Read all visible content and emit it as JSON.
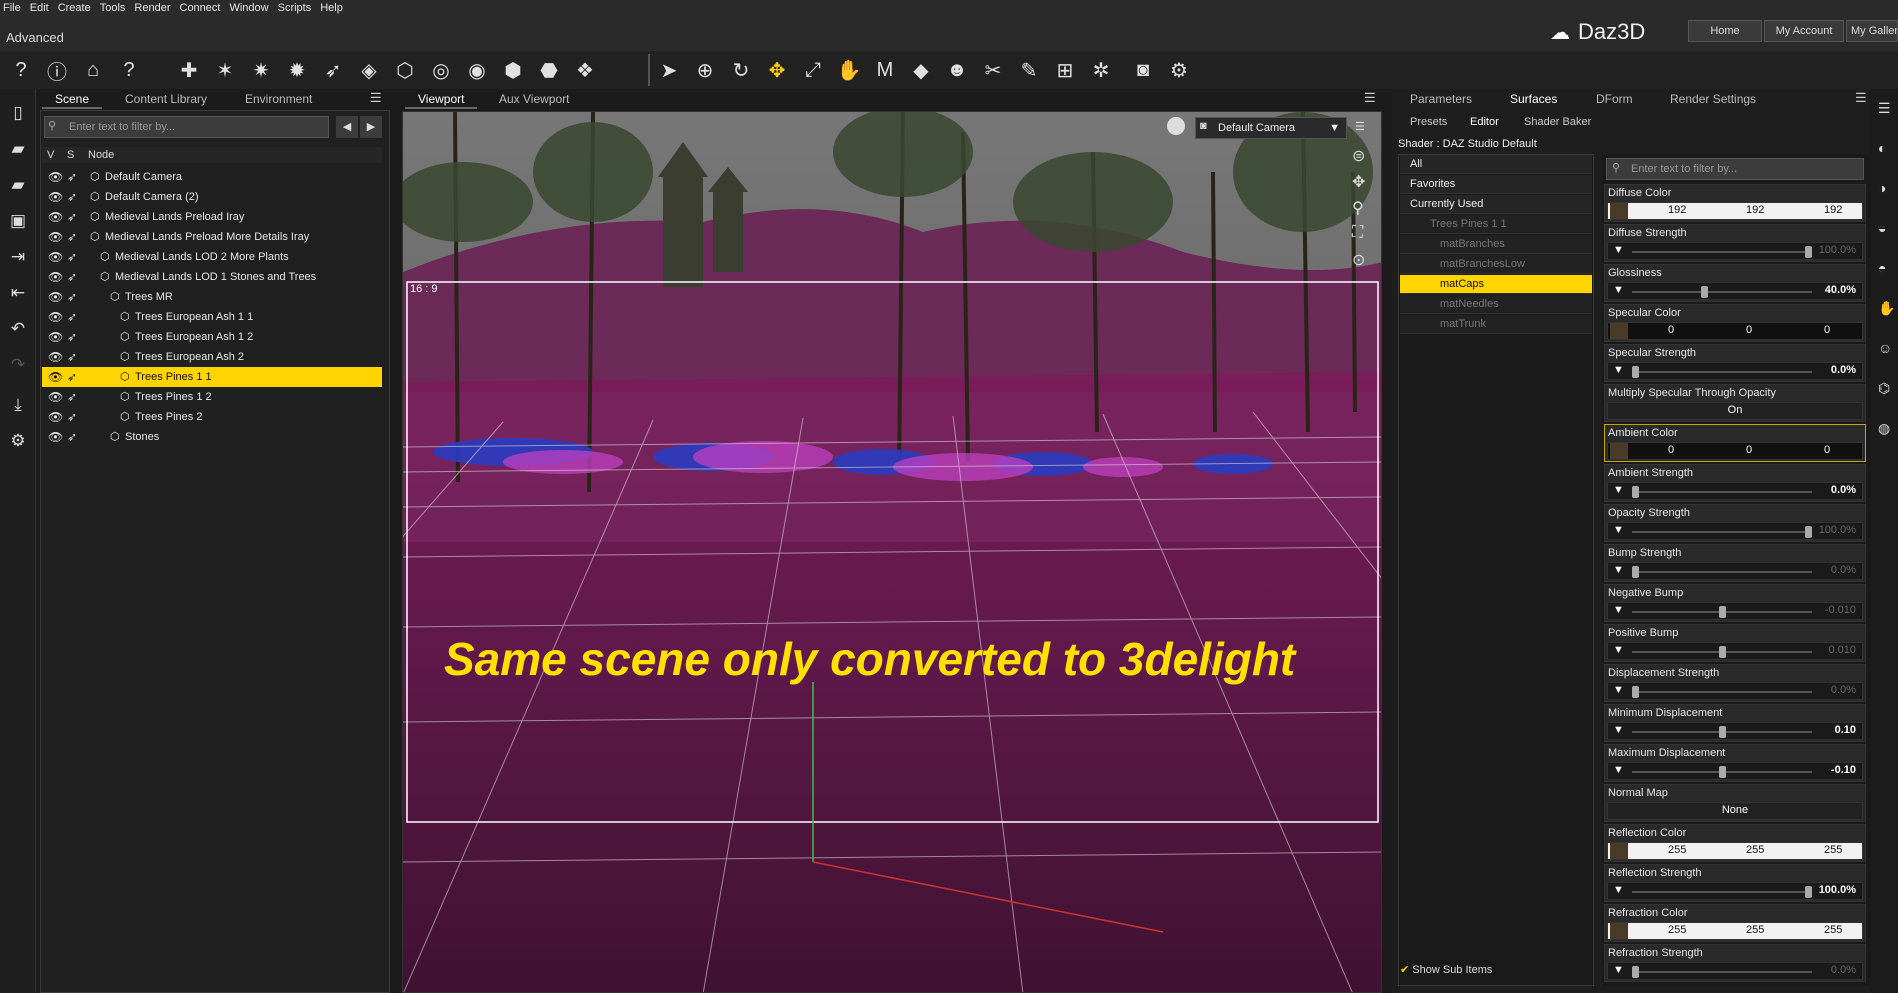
{
  "menu": [
    "File",
    "Edit",
    "Create",
    "Tools",
    "Render",
    "Connect",
    "Window",
    "Scripts",
    "Help"
  ],
  "layout_label": "Advanced",
  "brand": "Daz3D",
  "nav": {
    "home": "Home",
    "account": "My Account",
    "gallery": "My Gallery"
  },
  "scene_tabs": [
    "Scene",
    "Content Library",
    "Environment"
  ],
  "scene_filter_placeholder": "Enter text to filter by...",
  "tree_header": {
    "v": "V",
    "s": "S",
    "node": "Node"
  },
  "tree": [
    {
      "label": "Default Camera",
      "indent": 0
    },
    {
      "label": "Default Camera (2)",
      "indent": 0
    },
    {
      "label": "Medieval Lands Preload Iray",
      "indent": 0
    },
    {
      "label": "Medieval Lands Preload More Details Iray",
      "indent": 0
    },
    {
      "label": "Medieval Lands LOD 2 More Plants",
      "indent": 1
    },
    {
      "label": "Medieval Lands LOD 1 Stones and Trees",
      "indent": 1
    },
    {
      "label": "Trees MR",
      "indent": 2
    },
    {
      "label": "Trees European Ash 1 1",
      "indent": 3
    },
    {
      "label": "Trees European Ash 1 2",
      "indent": 3
    },
    {
      "label": "Trees European Ash 2",
      "indent": 3
    },
    {
      "label": "Trees Pines 1 1",
      "indent": 3,
      "selected": true
    },
    {
      "label": "Trees Pines 1 2",
      "indent": 3
    },
    {
      "label": "Trees Pines 2",
      "indent": 3
    },
    {
      "label": "Stones",
      "indent": 2
    }
  ],
  "viewport_tabs": [
    "Viewport",
    "Aux Viewport"
  ],
  "camera": "Default Camera",
  "aspect": "16 : 9",
  "overlay_text": "Same scene only converted to 3delight",
  "right_tabs": [
    "Parameters",
    "Surfaces",
    "DForm",
    "Render Settings"
  ],
  "sub_tabs": [
    "Presets",
    "Editor",
    "Shader Baker"
  ],
  "shader": "Shader : DAZ Studio Default",
  "categories": [
    "All",
    "Favorites",
    "Currently Used"
  ],
  "surface_root": "Trees Pines 1 1",
  "surfaces": [
    "matBranches",
    "matBranchesLow",
    "matCaps",
    "matNeedles",
    "matTrunk"
  ],
  "selected_surface": "matCaps",
  "prop_filter_placeholder": "Enter text to filter by...",
  "show_sub_items": "Show Sub Items",
  "props": [
    {
      "label": "Diffuse Color",
      "type": "color",
      "vals": [
        "192",
        "192",
        "192"
      ],
      "light": true
    },
    {
      "label": "Diffuse Strength",
      "type": "slider",
      "val": "100.0%",
      "pos": 1.0,
      "dim": true
    },
    {
      "label": "Glossiness",
      "type": "slider",
      "val": "40.0%",
      "pos": 0.4
    },
    {
      "label": "Specular Color",
      "type": "color",
      "vals": [
        "0",
        "0",
        "0"
      ]
    },
    {
      "label": "Specular Strength",
      "type": "slider",
      "val": "0.0%",
      "pos": 0.0
    },
    {
      "label": "Multiply Specular Through Opacity",
      "type": "toggle",
      "val": "On"
    },
    {
      "label": "Ambient Color",
      "type": "color",
      "vals": [
        "0",
        "0",
        "0"
      ],
      "hl": true
    },
    {
      "label": "Ambient Strength",
      "type": "slider",
      "val": "0.0%",
      "pos": 0.0
    },
    {
      "label": "Opacity Strength",
      "type": "slider",
      "val": "100.0%",
      "pos": 1.0,
      "dim": true
    },
    {
      "label": "Bump Strength",
      "type": "slider",
      "val": "0.0%",
      "pos": 0.0,
      "dim": true
    },
    {
      "label": "Negative Bump",
      "type": "slider",
      "val": "-0.010",
      "pos": 0.5,
      "dim": true
    },
    {
      "label": "Positive Bump",
      "type": "slider",
      "val": "0.010",
      "pos": 0.5,
      "dim": true
    },
    {
      "label": "Displacement Strength",
      "type": "slider",
      "val": "0.0%",
      "pos": 0.0,
      "dim": true
    },
    {
      "label": "Minimum Displacement",
      "type": "slider",
      "val": "0.10",
      "pos": 0.5
    },
    {
      "label": "Maximum Displacement",
      "type": "slider",
      "val": "-0.10",
      "pos": 0.5
    },
    {
      "label": "Normal Map",
      "type": "toggle",
      "val": "None"
    },
    {
      "label": "Reflection Color",
      "type": "color",
      "vals": [
        "255",
        "255",
        "255"
      ],
      "light": true
    },
    {
      "label": "Reflection Strength",
      "type": "slider",
      "val": "100.0%",
      "pos": 1.0
    },
    {
      "label": "Refraction Color",
      "type": "color",
      "vals": [
        "255",
        "255",
        "255"
      ],
      "light": true
    },
    {
      "label": "Refraction Strength",
      "type": "slider",
      "val": "0.0%",
      "pos": 0.0,
      "dim": true
    }
  ]
}
